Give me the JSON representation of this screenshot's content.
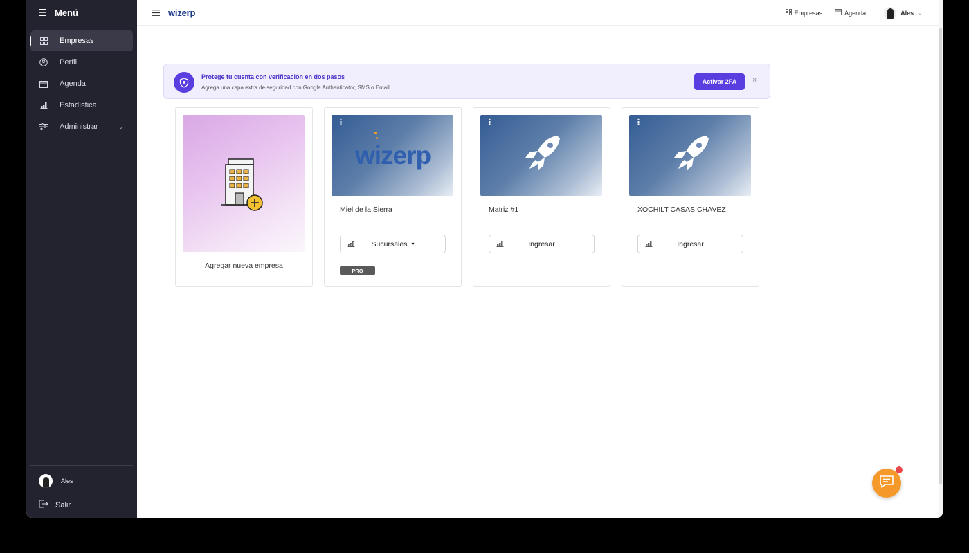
{
  "sidebar": {
    "title": "Menú",
    "items": [
      {
        "label": "Empresas",
        "icon": "grid-icon",
        "active": true
      },
      {
        "label": "Perfil",
        "icon": "user-circle-icon"
      },
      {
        "label": "Agenda",
        "icon": "calendar-icon"
      },
      {
        "label": "Estadística",
        "icon": "bar-chart-icon"
      },
      {
        "label": "Administrar",
        "icon": "sliders-icon",
        "has_submenu": true
      }
    ],
    "user_name": "Ales",
    "logout_label": "Salir"
  },
  "topbar": {
    "logo_text": "wizerp",
    "links": [
      {
        "label": "Empresas",
        "icon": "grid-icon"
      },
      {
        "label": "Agenda",
        "icon": "calendar-icon"
      }
    ],
    "user_name": "Ales"
  },
  "banner": {
    "title": "Protege tu cuenta con verificación en dos pasos",
    "subtitle": "Agrega una capa extra de seguridad con Google Authenticator, SMS o Email.",
    "button_label": "Activar 2FA",
    "close_label": "×"
  },
  "cards": {
    "add": {
      "label": "Agregar nueva empresa"
    },
    "companies": [
      {
        "name": "Miel de la Sierra",
        "action": "Sucursales",
        "has_dropdown": true,
        "badge": "PRO",
        "logo_text": "wizerp"
      },
      {
        "name": "Matriz #1",
        "action": "Ingresar"
      },
      {
        "name": "XOCHILT CASAS CHAVEZ",
        "action": "Ingresar"
      }
    ]
  },
  "colors": {
    "sidebar_bg": "#23232f",
    "accent": "#5b3ee0",
    "chat": "#f59a2a",
    "badge": "#5a5a5a"
  }
}
